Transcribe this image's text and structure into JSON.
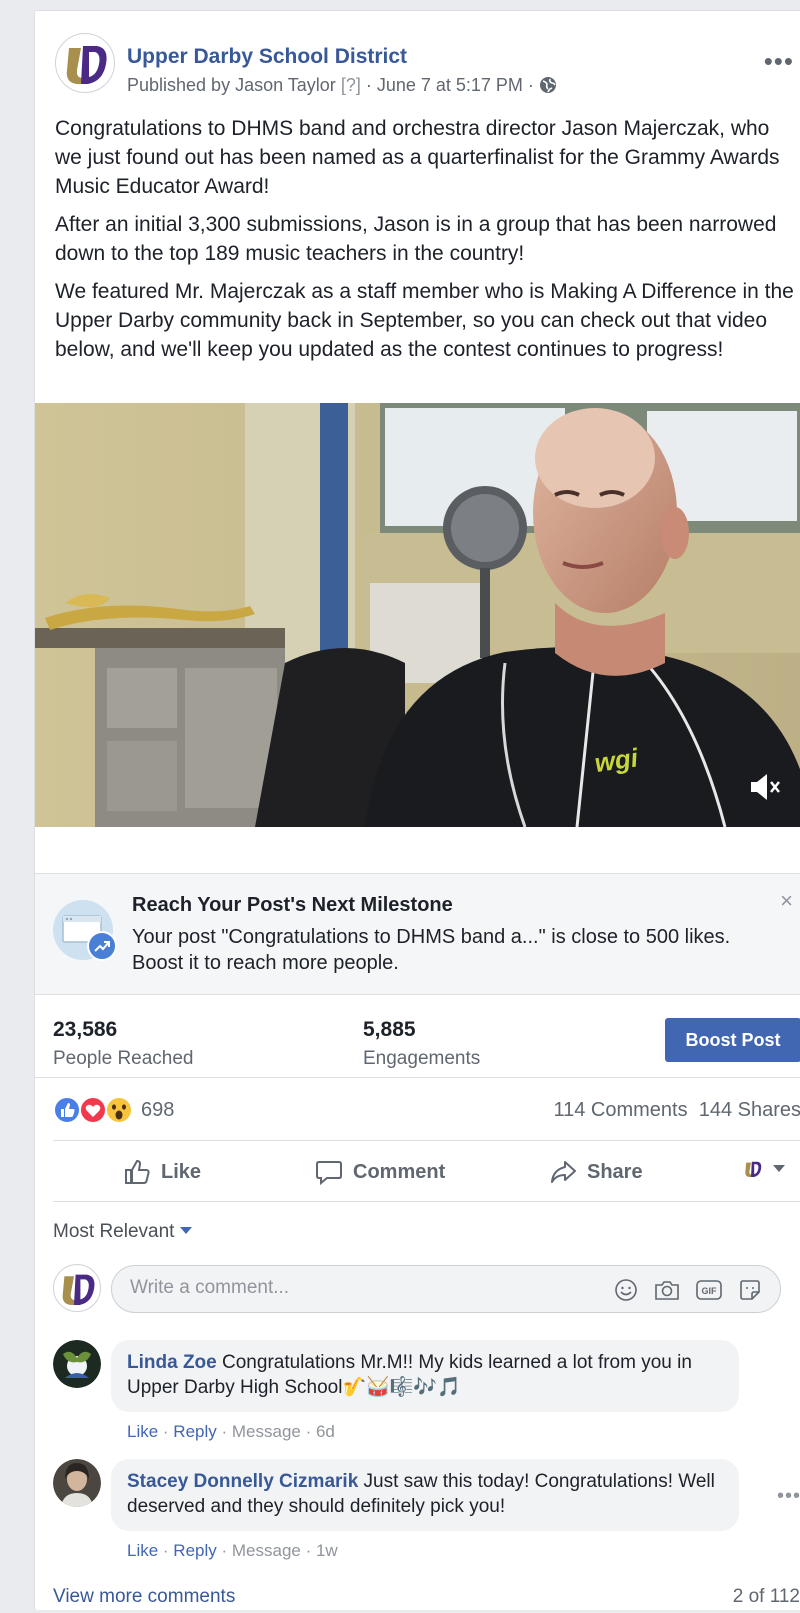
{
  "post": {
    "page_name": "Upper Darby School District",
    "published_prefix": "Published by Jason Taylor",
    "published_q": "[?]",
    "published_date": "· June 7 at 5:17 PM ·",
    "more": "•••",
    "paragraphs": [
      "Congratulations to DHMS band and orchestra director Jason Majerczak, who we just found out has been named as a quarterfinalist for the Grammy Awards Music Educator Award!",
      "After an initial 3,300 submissions, Jason is in a group that has been narrowed down to the top 189 music teachers in the country!",
      "We featured Mr. Majerczak as a staff member who is Making A Difference in the Upper Darby community back in September, so you can check out that video below, and we'll keep you updated as the contest continues to progress!"
    ],
    "video_shirt_logo": "wgi"
  },
  "milestone": {
    "title": "Reach Your Post's Next Milestone",
    "body": "Your post \"Congratulations to DHMS band a...\" is close to 500 likes. Boost it to reach more people.",
    "close": "×"
  },
  "stats": {
    "reached_value": "23,586",
    "reached_label": "People Reached",
    "engagements_value": "5,885",
    "engagements_label": "Engagements",
    "boost_label": "Boost Post"
  },
  "reactions": {
    "count": "698",
    "comments": "114 Comments",
    "shares": "144 Shares"
  },
  "actions": {
    "like": "Like",
    "comment": "Comment",
    "share": "Share"
  },
  "comments_section": {
    "sort_label": "Most Relevant",
    "composer_placeholder": "Write a comment...",
    "items": [
      {
        "author": "Linda Zoe",
        "text": "Congratulations Mr.M!! My kids learned a lot from you in Upper Darby High School🎷🥁🎼🎶🎵",
        "like": "Like",
        "reply": "Reply",
        "rest": "· Message · 6d"
      },
      {
        "author": "Stacey Donnelly Cizmarik",
        "text": "Just saw this today! Congratulations! Well deserved and they should definitely pick you!",
        "like": "Like",
        "reply": "Reply",
        "rest": "· Message · 1w"
      }
    ],
    "view_more": "View more comments",
    "pager": "2 of 112"
  },
  "colors": {
    "link_blue": "#385898",
    "button_blue": "#4267b2",
    "logo_gold": "#a88f4d",
    "logo_purple": "#4a2a85"
  }
}
